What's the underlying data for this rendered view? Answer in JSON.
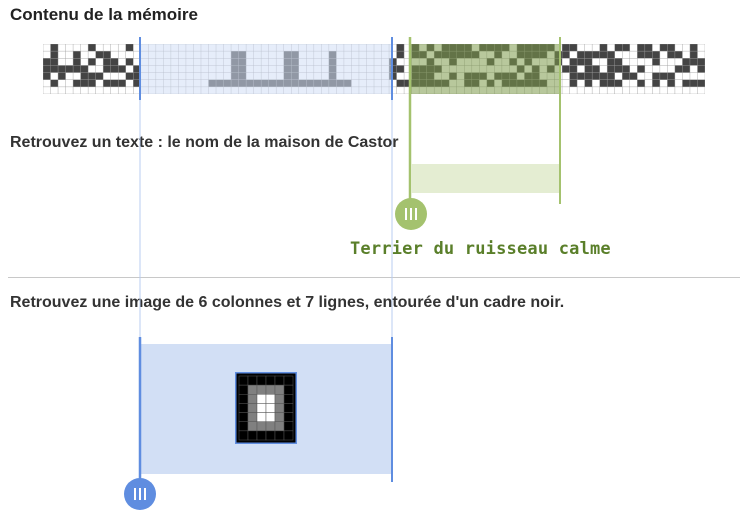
{
  "headings": {
    "memory": "Contenu de la mémoire",
    "task_text": "Retrouvez un texte : le nom de la maison de Castor",
    "task_image": "Retrouvez une image de 6 colonnes et 7 lignes, entourée d'un cadre noir."
  },
  "decoded_text": "Terrier du ruisseau calme",
  "colors": {
    "text_selection_fill": "#e4edd2",
    "text_selection_line": "#a4c26e",
    "image_selection_fill": "#d2dff5",
    "image_selection_line": "#5f8de0",
    "memory_dark": "#444444",
    "memory_light": "#ffffff"
  },
  "icons": {
    "text_handle": "grip-lines-icon",
    "image_handle": "grip-lines-icon"
  },
  "decoded_image": {
    "columns": 6,
    "rows": 7,
    "cells": [
      "kkkkkk",
      "kggggk",
      "kgwwgk",
      "kgwwgk",
      "kgwwgk",
      "kggggk",
      "kkkkkk"
    ]
  }
}
